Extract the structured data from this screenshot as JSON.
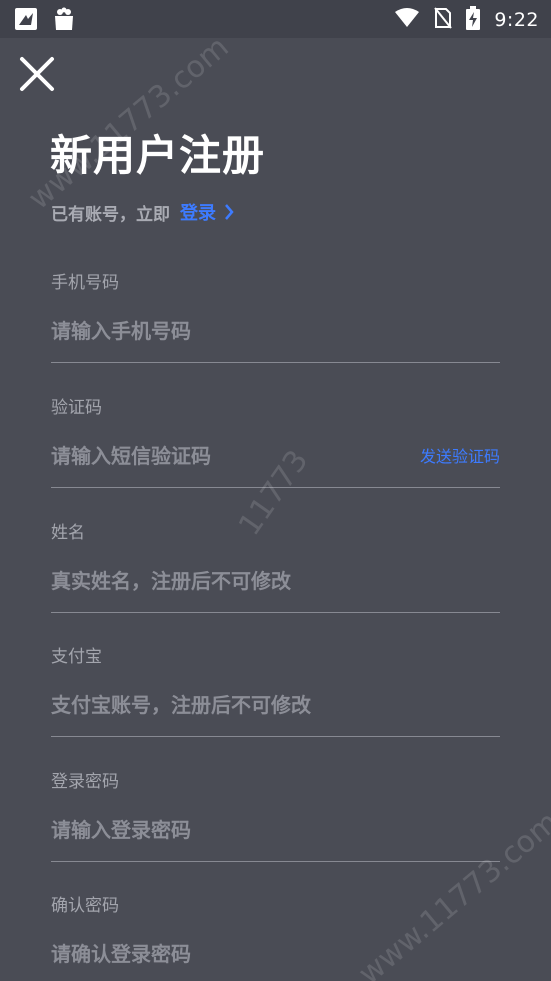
{
  "status_bar": {
    "time": "9:22",
    "icons": [
      "app-notification-icon",
      "shopping-bag-icon",
      "wifi-icon",
      "no-sim-icon",
      "battery-charging-icon"
    ]
  },
  "header": {
    "close_icon": "close-icon",
    "title": "新用户注册",
    "subtitle_prefix": "已有账号，立即",
    "login_link": "登录"
  },
  "form": {
    "phone": {
      "label": "手机号码",
      "placeholder": "请输入手机号码"
    },
    "code": {
      "label": "验证码",
      "placeholder": "请输入短信验证码",
      "action": "发送验证码"
    },
    "name": {
      "label": "姓名",
      "placeholder": "真实姓名，注册后不可修改"
    },
    "alipay": {
      "label": "支付宝",
      "placeholder": "支付宝账号，注册后不可修改"
    },
    "password": {
      "label": "登录密码",
      "placeholder": "请输入登录密码"
    },
    "confirm": {
      "label": "确认密码",
      "placeholder": "请确认登录密码"
    }
  },
  "watermarks": [
    "www.11773.com",
    "11773",
    "www.11773.com"
  ],
  "colors": {
    "background": "#4a4c55",
    "accent": "#3d7bff"
  }
}
